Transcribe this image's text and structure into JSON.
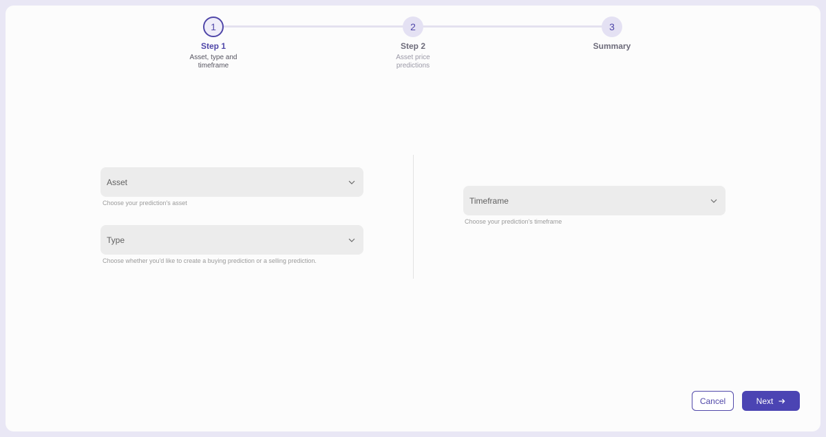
{
  "stepper": {
    "steps": [
      {
        "number": "1",
        "title": "Step 1",
        "subtitle": "Asset, type and timeframe"
      },
      {
        "number": "2",
        "title": "Step 2",
        "subtitle": "Asset price predictions"
      },
      {
        "number": "3",
        "title": "Summary",
        "subtitle": ""
      }
    ],
    "active_step": 1
  },
  "form": {
    "asset": {
      "label": "Asset",
      "helper": "Choose your prediction's asset"
    },
    "type": {
      "label": "Type",
      "helper": "Choose whether you'd like to create a buying prediction or a selling prediction."
    },
    "timeframe": {
      "label": "Timeframe",
      "helper": "Choose your prediction's timeframe"
    }
  },
  "actions": {
    "cancel_label": "Cancel",
    "next_label": "Next",
    "next_icon": "arrow-right-icon"
  },
  "colors": {
    "accent": "#4b44b3",
    "field_bg": "#ececec",
    "page_bg": "#e9e7f5"
  }
}
